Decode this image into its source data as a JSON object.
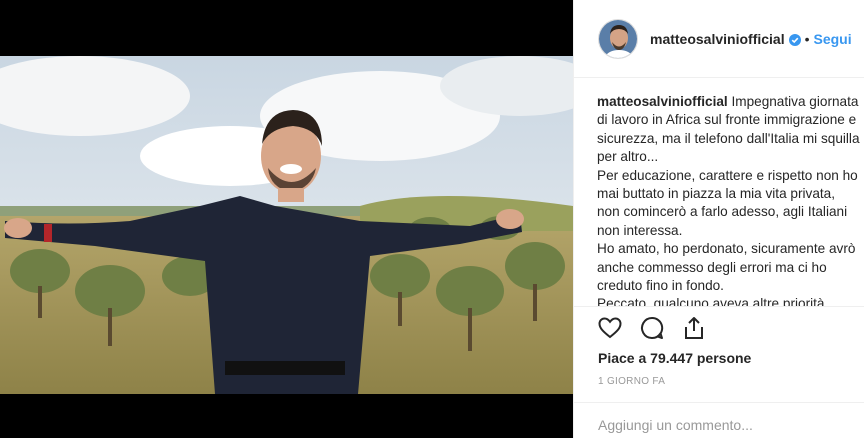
{
  "post": {
    "username": "matteosalviniofficial",
    "dot": "•",
    "follow_label": "Segui",
    "caption_user": "matteosalviniofficial",
    "caption_lines": [
      "Impegnativa giornata di lavoro in Africa sul fronte immigrazione e sicurezza, ma il telefono dall'Italia mi squilla per altro...",
      "Per educazione, carattere e rispetto non ho mai buttato in piazza la mia vita privata, non comincerò a farlo adesso, agli Italiani non interessa.",
      "Ho amato, ho perdonato, sicuramente avrò anche commesso degli errori ma ci ho creduto fino in fondo.",
      "Peccato, qualcuno aveva altre priorità."
    ],
    "likes_prefix": "Piace a ",
    "likes_count": "79.447",
    "likes_suffix": " persone",
    "time": "1 GIORNO FA",
    "comment_placeholder": "Aggiungi un commento..."
  },
  "icons": {
    "verified": "verified-badge-icon",
    "like": "heart-icon",
    "comment": "comment-icon",
    "share": "share-icon"
  },
  "colors": {
    "accent": "#3897f0",
    "text": "#262626",
    "muted": "#999999"
  }
}
